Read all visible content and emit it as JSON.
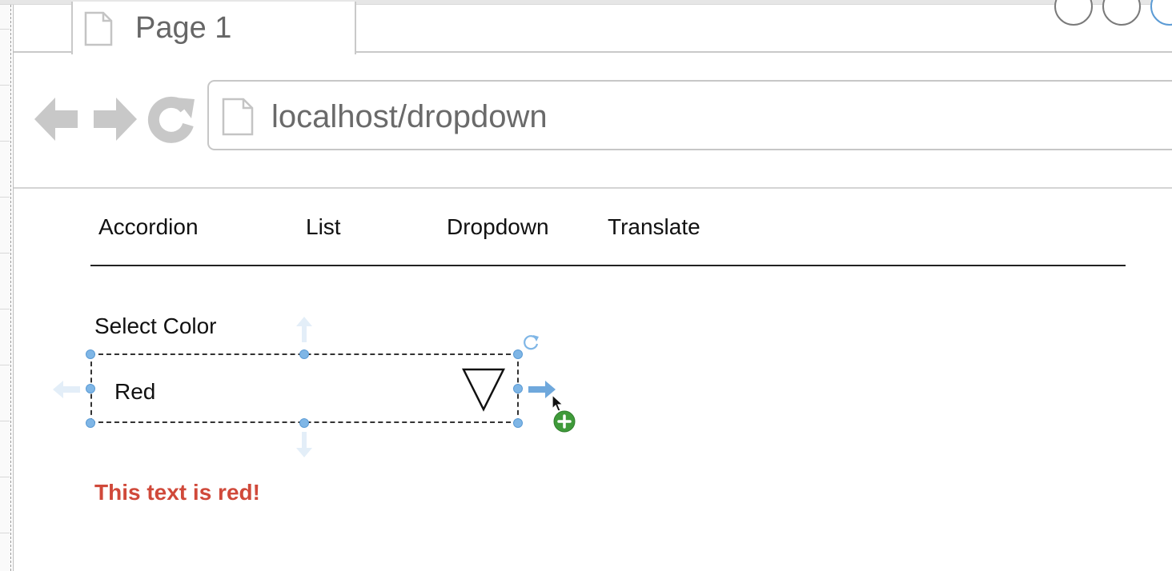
{
  "browser": {
    "tab_title": "Page 1",
    "url": "localhost/dropdown",
    "icons": {
      "tab": "page-icon",
      "back": "back-arrow-icon",
      "forward": "forward-arrow-icon",
      "reload": "reload-icon",
      "address": "page-icon"
    }
  },
  "nav": {
    "items": [
      {
        "label": "Accordion"
      },
      {
        "label": "List"
      },
      {
        "label": "Dropdown"
      },
      {
        "label": "Translate"
      }
    ]
  },
  "form": {
    "label": "Select Color",
    "selected_value": "Red",
    "arrow_icon": "triangle-down-icon"
  },
  "result": {
    "text": "This text is red!",
    "color": "#d0493a"
  },
  "editor": {
    "handle_color": "#7fb6e6",
    "add_badge_color": "#3f9a3a",
    "icons": [
      "rotate-icon",
      "connect-arrow-icon",
      "add-icon",
      "cursor-icon"
    ]
  }
}
